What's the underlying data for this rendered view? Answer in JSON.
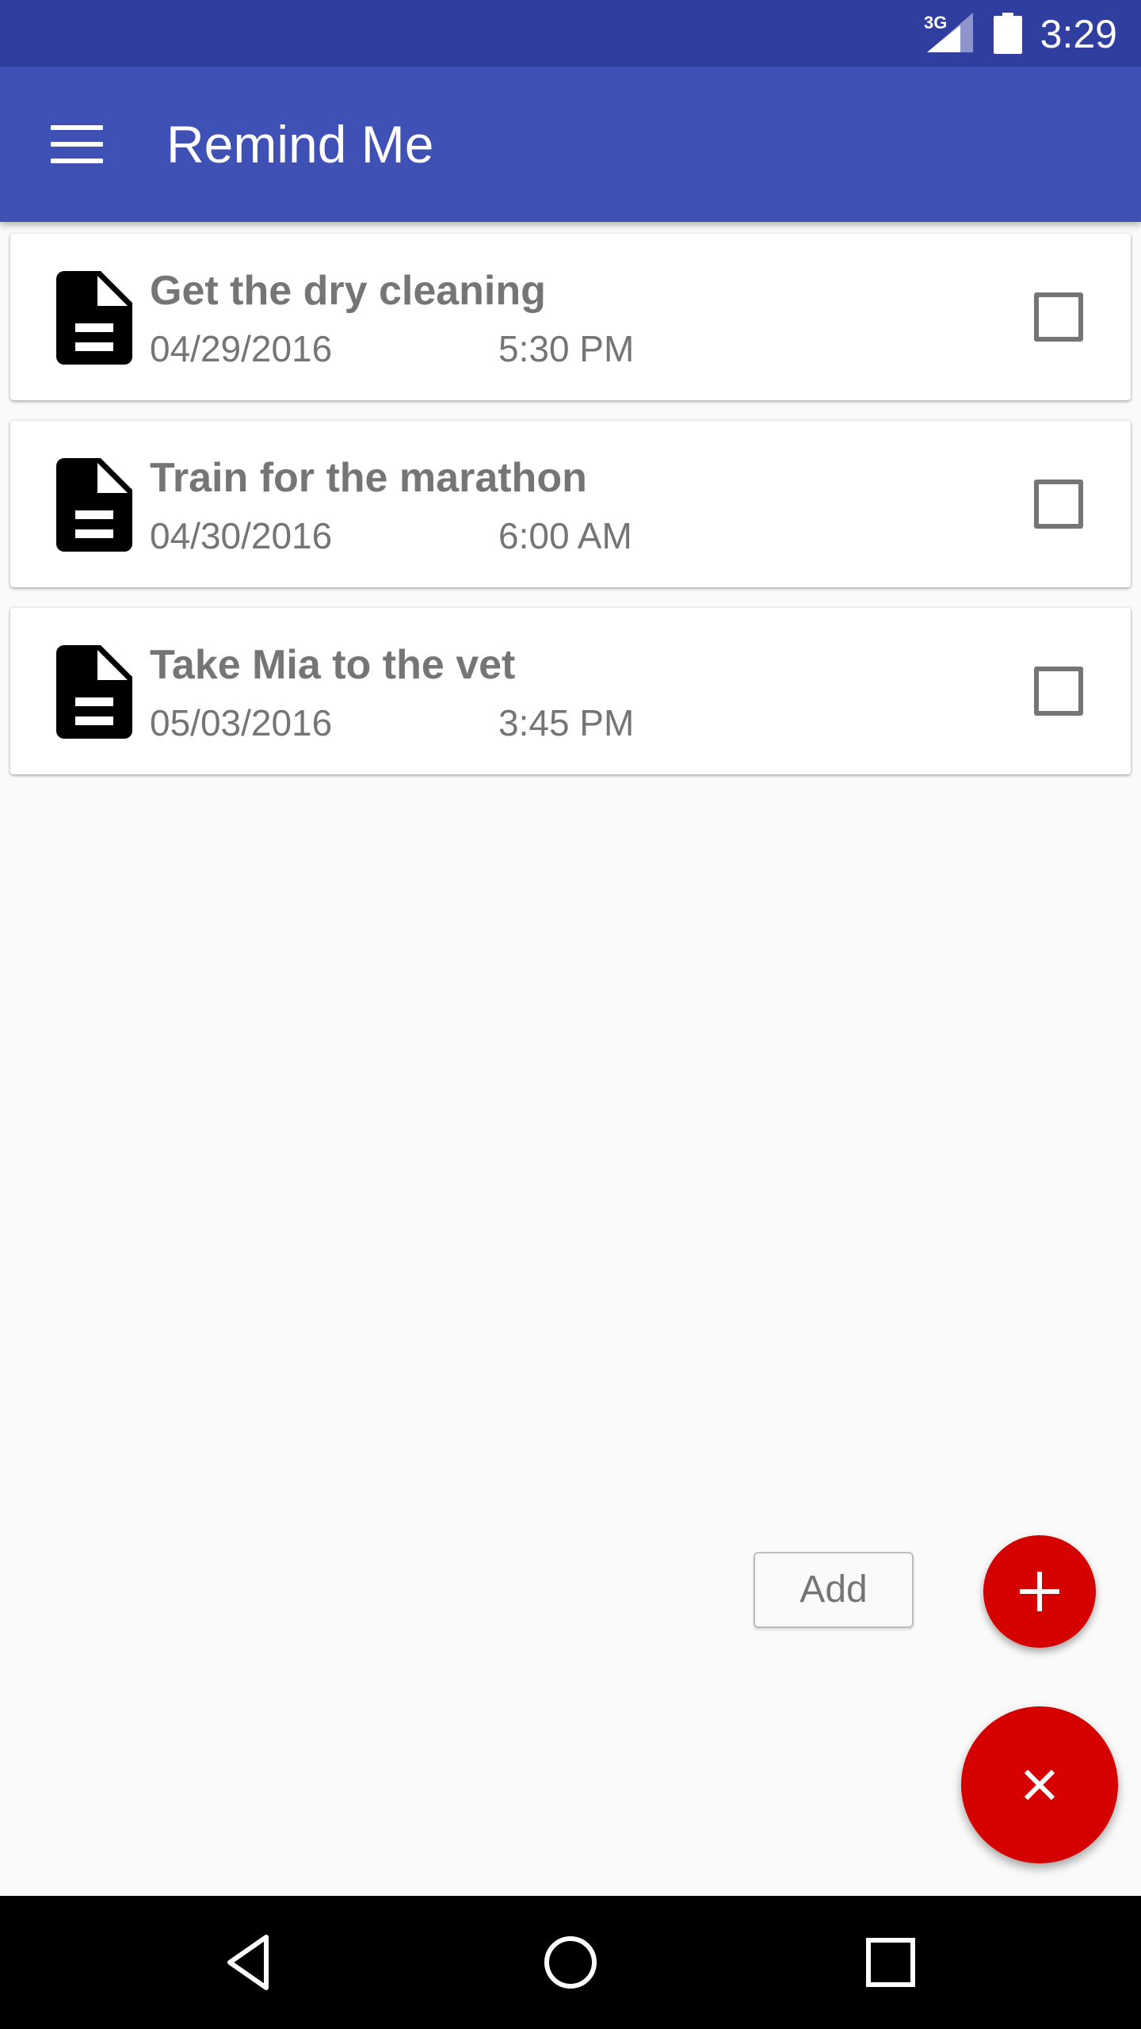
{
  "status_bar": {
    "network": "3G",
    "time": "3:29",
    "icons": [
      "signal-icon",
      "battery-icon"
    ]
  },
  "app_bar": {
    "title": "Remind Me",
    "menu_icon": "hamburger-menu-icon"
  },
  "reminders": [
    {
      "title": "Get the dry cleaning",
      "date": "04/29/2016",
      "time": "5:30 PM",
      "checked": false,
      "icon": "document-icon"
    },
    {
      "title": "Train for the marathon",
      "date": "04/30/2016",
      "time": "6:00 AM",
      "checked": false,
      "icon": "document-icon"
    },
    {
      "title": "Take Mia to the vet",
      "date": "05/03/2016",
      "time": "3:45 PM",
      "checked": false,
      "icon": "document-icon"
    }
  ],
  "fab": {
    "add_label": "Add",
    "add_icon": "plus-icon",
    "close_icon": "close-icon",
    "color": "#d50000"
  },
  "nav_bar": {
    "buttons": [
      "back-icon",
      "home-icon",
      "recents-icon"
    ]
  },
  "colors": {
    "status_bar": "#303f9f",
    "app_bar": "#3f51b5",
    "background": "#fafafa",
    "text_secondary": "#757575"
  }
}
